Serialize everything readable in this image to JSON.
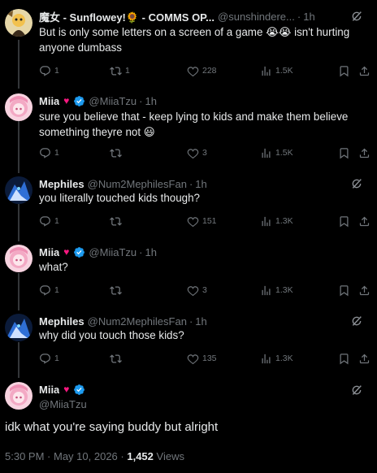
{
  "thread": [
    {
      "name": "魔女 - Sunflowey!🌻 - COMMS OP...",
      "handle": "@sunshindere...",
      "time": "1h",
      "text": "But is only some letters on a screen of a game 😭😭 isn't hurting anyone dumbass",
      "replies": "1",
      "reposts": "1",
      "likes": "228",
      "views": "1.5K"
    },
    {
      "name": "Miia",
      "handle": "@MiiaTzu",
      "time": "1h",
      "text": "sure you believe that - keep lying to kids and make them believe something theyre not 😃",
      "replies": "1",
      "reposts": "",
      "likes": "3",
      "views": "1.5K"
    },
    {
      "name": "Mephiles",
      "handle": "@Num2MephilesFan",
      "time": "1h",
      "text": "you literally touched kids though?",
      "replies": "1",
      "reposts": "",
      "likes": "151",
      "views": "1.3K"
    },
    {
      "name": "Miia",
      "handle": "@MiiaTzu",
      "time": "1h",
      "text": "what?",
      "replies": "1",
      "reposts": "",
      "likes": "3",
      "views": "1.3K"
    },
    {
      "name": "Mephiles",
      "handle": "@Num2MephilesFan",
      "time": "1h",
      "text": "why did you touch those kids?",
      "replies": "1",
      "reposts": "",
      "likes": "135",
      "views": "1.3K"
    }
  ],
  "main": {
    "name": "Miia",
    "handle": "@MiiaTzu",
    "text": "idk what you're saying buddy but alright",
    "time": "5:30 PM",
    "date": "May 10, 2026",
    "views_count": "1,452",
    "views_label": "Views"
  },
  "colors": {
    "background": "#000000",
    "text": "#e7e9ea",
    "muted": "#71767b",
    "verified": "#1d9bf0",
    "heart": "#f91880"
  },
  "icons": [
    "reply-icon",
    "repost-icon",
    "like-icon",
    "views-icon",
    "bookmark-icon",
    "share-icon",
    "grok-icon",
    "verified-badge-icon"
  ]
}
